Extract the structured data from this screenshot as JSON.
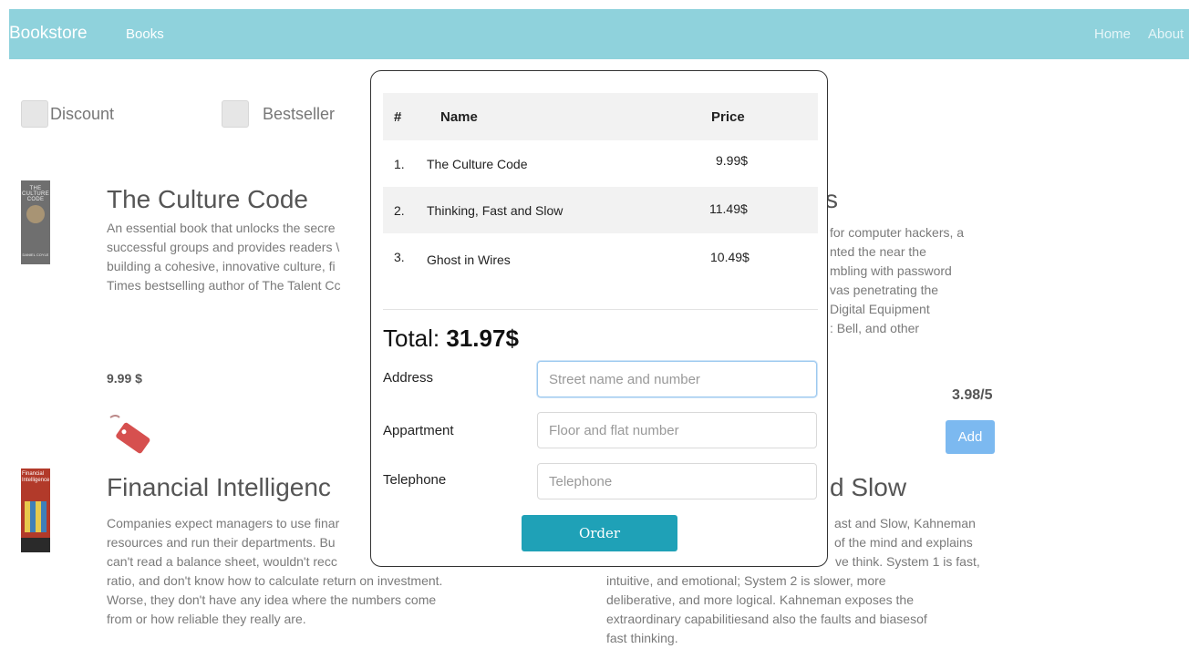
{
  "nav": {
    "brand": "Bookstore",
    "books": "Books",
    "home": "Home",
    "about": "About"
  },
  "filters": {
    "discount": "Discount",
    "bestseller": "Bestseller"
  },
  "books": [
    {
      "title": "The Culture Code",
      "desc_lines": [
        "An essential book that unlocks the secre",
        "successful groups and provides readers \\",
        "building a cohesive, innovative culture, fi",
        "Times bestselling author of The Talent Cc"
      ],
      "price": "9.99 $",
      "cover_title": "THE CULTURE CODE",
      "cover_author": "DANIEL COYLE"
    },
    {
      "title_clip": "s",
      "desc_lines": [
        "for computer hackers, a",
        "nted the near the",
        "mbling with password",
        "vas penetrating the",
        "Digital Equipment",
        ": Bell, and other"
      ],
      "rating": "3.98/5",
      "add_label": "Add"
    },
    {
      "title": "Financial Intelligenc",
      "desc_lines": [
        "Companies expect managers to use finar",
        "resources and run their departments. Bu",
        "can't read a balance sheet, wouldn't recc",
        "ratio, and don't know how to calculate return on investment.",
        "Worse, they don't have any idea where the numbers come",
        "from or how reliable they really are."
      ],
      "cover_title": "Financial Intelligence"
    },
    {
      "title_clip": "d Slow",
      "desc_lines": [
        "ast and Slow, Kahneman",
        "of the mind and explains",
        "ve think. System 1 is fast,",
        "intuitive, and emotional; System 2 is slower, more",
        "deliberative, and more logical. Kahneman exposes the",
        "extraordinary capabilitiesand also the faults and biasesof",
        "fast thinking."
      ]
    }
  ],
  "cart": {
    "headers": {
      "num": "#",
      "name": "Name",
      "price": "Price"
    },
    "rows": [
      {
        "num": "1.",
        "name": "The Culture Code",
        "price": "9.99$"
      },
      {
        "num": "2.",
        "name": "Thinking, Fast and Slow",
        "price": "11.49$"
      },
      {
        "num": "3.",
        "name": "Ghost in Wires",
        "price": "10.49$"
      }
    ],
    "total_label": "Total:",
    "total_value": "31.97$",
    "form": {
      "address_label": "Address",
      "address_placeholder": "Street name and number",
      "apartment_label": "Appartment",
      "apartment_placeholder": "Floor and flat number",
      "telephone_label": "Telephone",
      "telephone_placeholder": "Telephone"
    },
    "order_label": "Order"
  },
  "colors": {
    "navbar": "#8fd2dc",
    "order_button": "#1fa1b7",
    "add_button": "#7cb9f0"
  }
}
